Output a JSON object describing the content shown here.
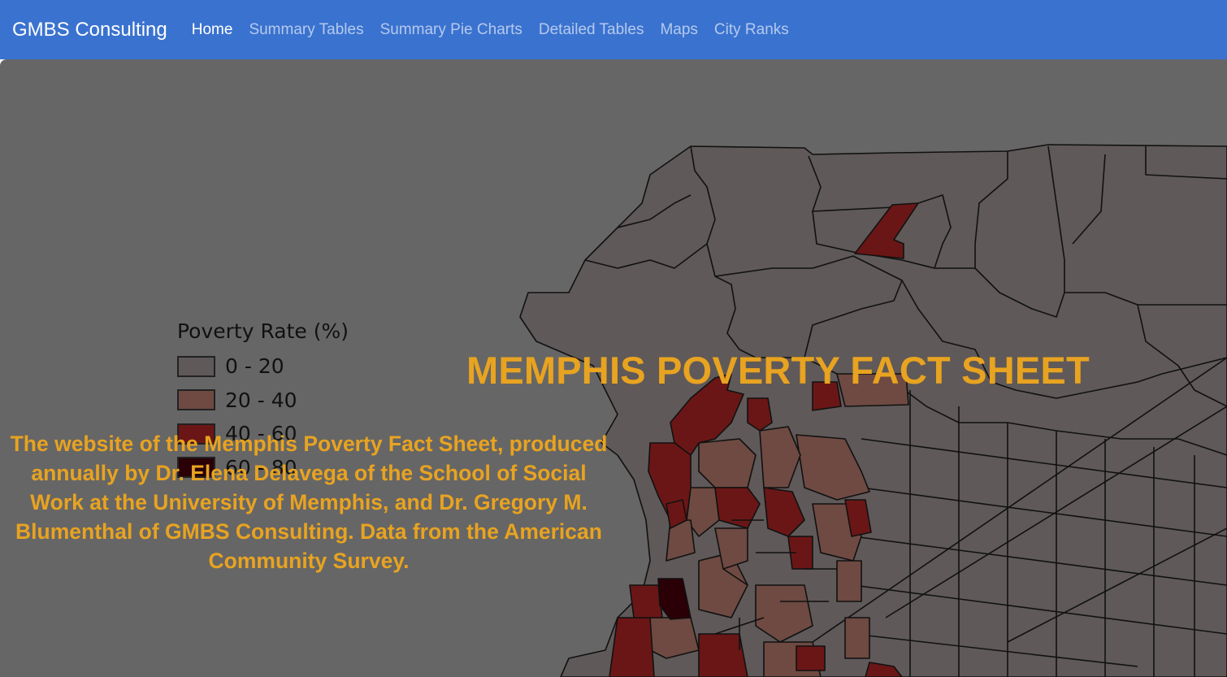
{
  "navbar": {
    "brand": "GMBS Consulting",
    "items": [
      {
        "label": "Home",
        "active": true
      },
      {
        "label": "Summary Tables",
        "active": false
      },
      {
        "label": "Summary Pie Charts",
        "active": false
      },
      {
        "label": "Detailed Tables",
        "active": false
      },
      {
        "label": "Maps",
        "active": false
      },
      {
        "label": "City Ranks",
        "active": false
      }
    ]
  },
  "hero": {
    "title": "MEMPHIS POVERTY FACT SHEET",
    "description": "The website of the Memphis Poverty Fact Sheet, produced annually by Dr. Elena Delavega of the School of Social Work at the University of Memphis, and Dr. Gregory M. Blumenthal of GMBS Consulting. Data from the American Community Survey."
  },
  "legend": {
    "title": "Poverty Rate (%)",
    "items": [
      {
        "label": "0 - 20",
        "color": "#5f5959"
      },
      {
        "label": "20 - 40",
        "color": "#6e4a42"
      },
      {
        "label": "40 - 60",
        "color": "#6b1616"
      },
      {
        "label": "60 - 80",
        "color": "#2a0006"
      }
    ]
  },
  "colors": {
    "navbar": "#3a72cf",
    "accent": "#e8a320",
    "background": "#666666"
  }
}
